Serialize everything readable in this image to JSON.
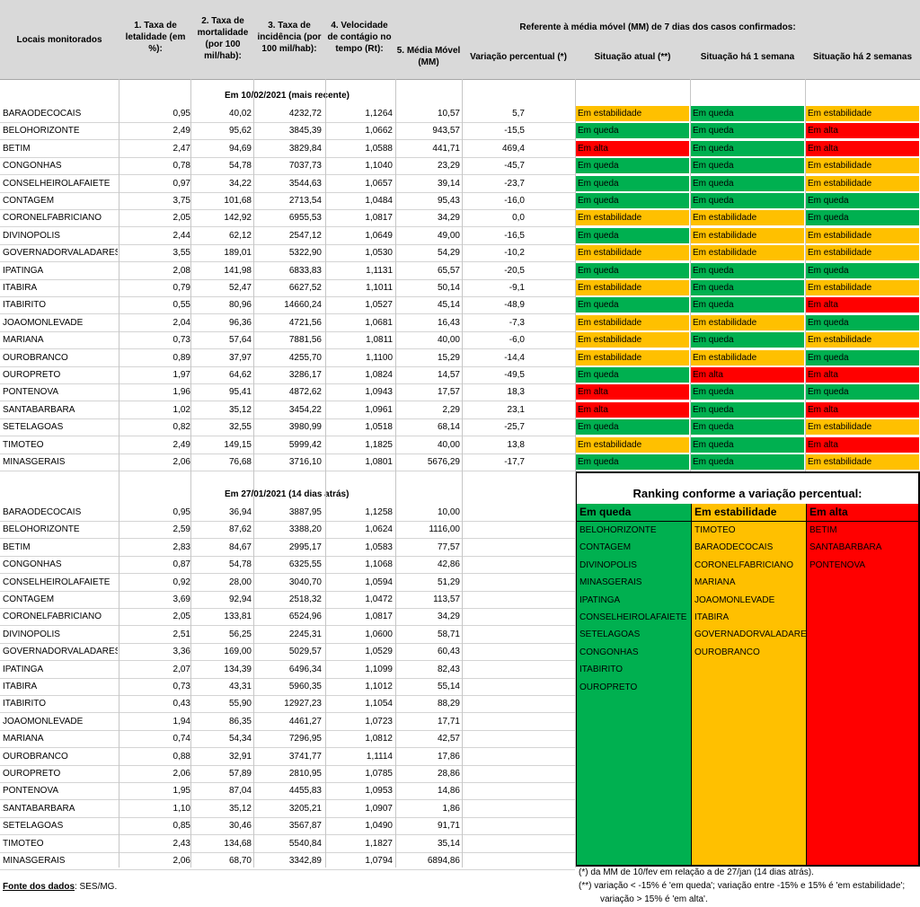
{
  "header": {
    "col_locais": "Locais monitorados",
    "col1": "1. Taxa de letalidade (em %):",
    "col2": "2. Taxa de mortalidade (por 100 mil/hab):",
    "col3": "3. Taxa de incidência (por 100 mil/hab):",
    "col4": "4. Velocidade de contágio no tempo (Rt):",
    "group": "Referente à média móvel (MM) de 7 dias  dos casos confirmados:",
    "col5": "5. Média Móvel (MM)",
    "col6": "Variação percentual (*)",
    "col7": "Situação atual (**)",
    "col8": "Situação há 1 semana",
    "col9": "Situação há 2 semanas"
  },
  "section1": {
    "title": "Em 10/02/2021 (mais recente)",
    "rows": [
      {
        "name": "BARAODECOCAIS",
        "c1": "0,95",
        "c2": "40,02",
        "c3": "4232,72",
        "c4": "1,1264",
        "c5": "10,57",
        "c6": "5,7",
        "s1": "Em estabilidade",
        "s2": "Em queda",
        "s3": "Em estabilidade"
      },
      {
        "name": "BELOHORIZONTE",
        "c1": "2,49",
        "c2": "95,62",
        "c3": "3845,39",
        "c4": "1,0662",
        "c5": "943,57",
        "c6": "-15,5",
        "s1": "Em queda",
        "s2": "Em queda",
        "s3": "Em alta"
      },
      {
        "name": "BETIM",
        "c1": "2,47",
        "c2": "94,69",
        "c3": "3829,84",
        "c4": "1,0588",
        "c5": "441,71",
        "c6": "469,4",
        "s1": "Em alta",
        "s2": "Em queda",
        "s3": "Em alta"
      },
      {
        "name": "CONGONHAS",
        "c1": "0,78",
        "c2": "54,78",
        "c3": "7037,73",
        "c4": "1,1040",
        "c5": "23,29",
        "c6": "-45,7",
        "s1": "Em queda",
        "s2": "Em queda",
        "s3": "Em estabilidade"
      },
      {
        "name": "CONSELHEIROLAFAIETE",
        "c1": "0,97",
        "c2": "34,22",
        "c3": "3544,63",
        "c4": "1,0657",
        "c5": "39,14",
        "c6": "-23,7",
        "s1": "Em queda",
        "s2": "Em queda",
        "s3": "Em estabilidade"
      },
      {
        "name": "CONTAGEM",
        "c1": "3,75",
        "c2": "101,68",
        "c3": "2713,54",
        "c4": "1,0484",
        "c5": "95,43",
        "c6": "-16,0",
        "s1": "Em queda",
        "s2": "Em queda",
        "s3": "Em queda"
      },
      {
        "name": "CORONELFABRICIANO",
        "c1": "2,05",
        "c2": "142,92",
        "c3": "6955,53",
        "c4": "1,0817",
        "c5": "34,29",
        "c6": "0,0",
        "s1": "Em estabilidade",
        "s2": "Em estabilidade",
        "s3": "Em queda"
      },
      {
        "name": "DIVINOPOLIS",
        "c1": "2,44",
        "c2": "62,12",
        "c3": "2547,12",
        "c4": "1,0649",
        "c5": "49,00",
        "c6": "-16,5",
        "s1": "Em queda",
        "s2": "Em estabilidade",
        "s3": "Em estabilidade"
      },
      {
        "name": "GOVERNADORVALADARES",
        "c1": "3,55",
        "c2": "189,01",
        "c3": "5322,90",
        "c4": "1,0530",
        "c5": "54,29",
        "c6": "-10,2",
        "s1": "Em estabilidade",
        "s2": "Em estabilidade",
        "s3": "Em estabilidade"
      },
      {
        "name": "IPATINGA",
        "c1": "2,08",
        "c2": "141,98",
        "c3": "6833,83",
        "c4": "1,1131",
        "c5": "65,57",
        "c6": "-20,5",
        "s1": "Em queda",
        "s2": "Em queda",
        "s3": "Em queda"
      },
      {
        "name": "ITABIRA",
        "c1": "0,79",
        "c2": "52,47",
        "c3": "6627,52",
        "c4": "1,1011",
        "c5": "50,14",
        "c6": "-9,1",
        "s1": "Em estabilidade",
        "s2": "Em queda",
        "s3": "Em estabilidade"
      },
      {
        "name": "ITABIRITO",
        "c1": "0,55",
        "c2": "80,96",
        "c3": "14660,24",
        "c4": "1,0527",
        "c5": "45,14",
        "c6": "-48,9",
        "s1": "Em queda",
        "s2": "Em queda",
        "s3": "Em alta"
      },
      {
        "name": "JOAOMONLEVADE",
        "c1": "2,04",
        "c2": "96,36",
        "c3": "4721,56",
        "c4": "1,0681",
        "c5": "16,43",
        "c6": "-7,3",
        "s1": "Em estabilidade",
        "s2": "Em estabilidade",
        "s3": "Em queda"
      },
      {
        "name": "MARIANA",
        "c1": "0,73",
        "c2": "57,64",
        "c3": "7881,56",
        "c4": "1,0811",
        "c5": "40,00",
        "c6": "-6,0",
        "s1": "Em estabilidade",
        "s2": "Em queda",
        "s3": "Em estabilidade"
      },
      {
        "name": "OUROBRANCO",
        "c1": "0,89",
        "c2": "37,97",
        "c3": "4255,70",
        "c4": "1,1100",
        "c5": "15,29",
        "c6": "-14,4",
        "s1": "Em estabilidade",
        "s2": "Em estabilidade",
        "s3": "Em queda"
      },
      {
        "name": "OUROPRETO",
        "c1": "1,97",
        "c2": "64,62",
        "c3": "3286,17",
        "c4": "1,0824",
        "c5": "14,57",
        "c6": "-49,5",
        "s1": "Em queda",
        "s2": "Em alta",
        "s3": "Em alta"
      },
      {
        "name": "PONTENOVA",
        "c1": "1,96",
        "c2": "95,41",
        "c3": "4872,62",
        "c4": "1,0943",
        "c5": "17,57",
        "c6": "18,3",
        "s1": "Em alta",
        "s2": "Em queda",
        "s3": "Em queda"
      },
      {
        "name": "SANTABARBARA",
        "c1": "1,02",
        "c2": "35,12",
        "c3": "3454,22",
        "c4": "1,0961",
        "c5": "2,29",
        "c6": "23,1",
        "s1": "Em alta",
        "s2": "Em queda",
        "s3": "Em alta"
      },
      {
        "name": "SETELAGOAS",
        "c1": "0,82",
        "c2": "32,55",
        "c3": "3980,99",
        "c4": "1,0518",
        "c5": "68,14",
        "c6": "-25,7",
        "s1": "Em queda",
        "s2": "Em queda",
        "s3": "Em estabilidade"
      },
      {
        "name": "TIMOTEO",
        "c1": "2,49",
        "c2": "149,15",
        "c3": "5999,42",
        "c4": "1,1825",
        "c5": "40,00",
        "c6": "13,8",
        "s1": "Em estabilidade",
        "s2": "Em queda",
        "s3": "Em alta"
      },
      {
        "name": "MINASGERAIS",
        "c1": "2,06",
        "c2": "76,68",
        "c3": "3716,10",
        "c4": "1,0801",
        "c5": "5676,29",
        "c6": "-17,7",
        "s1": "Em queda",
        "s2": "Em queda",
        "s3": "Em estabilidade"
      }
    ]
  },
  "section2": {
    "title": "Em 27/01/2021 (14 dias atrás)",
    "rows": [
      {
        "name": "BARAODECOCAIS",
        "c1": "0,95",
        "c2": "36,94",
        "c3": "3887,95",
        "c4": "1,1258",
        "c5": "10,00"
      },
      {
        "name": "BELOHORIZONTE",
        "c1": "2,59",
        "c2": "87,62",
        "c3": "3388,20",
        "c4": "1,0624",
        "c5": "1116,00"
      },
      {
        "name": "BETIM",
        "c1": "2,83",
        "c2": "84,67",
        "c3": "2995,17",
        "c4": "1,0583",
        "c5": "77,57"
      },
      {
        "name": "CONGONHAS",
        "c1": "0,87",
        "c2": "54,78",
        "c3": "6325,55",
        "c4": "1,1068",
        "c5": "42,86"
      },
      {
        "name": "CONSELHEIROLAFAIETE",
        "c1": "0,92",
        "c2": "28,00",
        "c3": "3040,70",
        "c4": "1,0594",
        "c5": "51,29"
      },
      {
        "name": "CONTAGEM",
        "c1": "3,69",
        "c2": "92,94",
        "c3": "2518,32",
        "c4": "1,0472",
        "c5": "113,57"
      },
      {
        "name": "CORONELFABRICIANO",
        "c1": "2,05",
        "c2": "133,81",
        "c3": "6524,96",
        "c4": "1,0817",
        "c5": "34,29"
      },
      {
        "name": "DIVINOPOLIS",
        "c1": "2,51",
        "c2": "56,25",
        "c3": "2245,31",
        "c4": "1,0600",
        "c5": "58,71"
      },
      {
        "name": "GOVERNADORVALADARES",
        "c1": "3,36",
        "c2": "169,00",
        "c3": "5029,57",
        "c4": "1,0529",
        "c5": "60,43"
      },
      {
        "name": "IPATINGA",
        "c1": "2,07",
        "c2": "134,39",
        "c3": "6496,34",
        "c4": "1,1099",
        "c5": "82,43"
      },
      {
        "name": "ITABIRA",
        "c1": "0,73",
        "c2": "43,31",
        "c3": "5960,35",
        "c4": "1,1012",
        "c5": "55,14"
      },
      {
        "name": "ITABIRITO",
        "c1": "0,43",
        "c2": "55,90",
        "c3": "12927,23",
        "c4": "1,1054",
        "c5": "88,29"
      },
      {
        "name": "JOAOMONLEVADE",
        "c1": "1,94",
        "c2": "86,35",
        "c3": "4461,27",
        "c4": "1,0723",
        "c5": "17,71"
      },
      {
        "name": "MARIANA",
        "c1": "0,74",
        "c2": "54,34",
        "c3": "7296,95",
        "c4": "1,0812",
        "c5": "42,57"
      },
      {
        "name": "OUROBRANCO",
        "c1": "0,88",
        "c2": "32,91",
        "c3": "3741,77",
        "c4": "1,1114",
        "c5": "17,86"
      },
      {
        "name": "OUROPRETO",
        "c1": "2,06",
        "c2": "57,89",
        "c3": "2810,95",
        "c4": "1,0785",
        "c5": "28,86"
      },
      {
        "name": "PONTENOVA",
        "c1": "1,95",
        "c2": "87,04",
        "c3": "4455,83",
        "c4": "1,0953",
        "c5": "14,86"
      },
      {
        "name": "SANTABARBARA",
        "c1": "1,10",
        "c2": "35,12",
        "c3": "3205,21",
        "c4": "1,0907",
        "c5": "1,86"
      },
      {
        "name": "SETELAGOAS",
        "c1": "0,85",
        "c2": "30,46",
        "c3": "3567,87",
        "c4": "1,0490",
        "c5": "91,71"
      },
      {
        "name": "TIMOTEO",
        "c1": "2,43",
        "c2": "134,68",
        "c3": "5540,84",
        "c4": "1,1827",
        "c5": "35,14"
      },
      {
        "name": "MINASGERAIS",
        "c1": "2,06",
        "c2": "68,70",
        "c3": "3342,89",
        "c4": "1,0794",
        "c5": "6894,86"
      }
    ]
  },
  "ranking": {
    "title": "Ranking conforme a variação percentual:",
    "queda_label": "Em queda",
    "estabilidade_label": "Em estabilidade",
    "alta_label": "Em alta",
    "queda": [
      "BELOHORIZONTE",
      "CONTAGEM",
      "DIVINOPOLIS",
      "MINASGERAIS",
      "IPATINGA",
      "CONSELHEIROLAFAIETE",
      "SETELAGOAS",
      "CONGONHAS",
      "ITABIRITO",
      "OUROPRETO"
    ],
    "estabilidade": [
      "TIMOTEO",
      "BARAODECOCAIS",
      "CORONELFABRICIANO",
      "MARIANA",
      "JOAOMONLEVADE",
      "ITABIRA",
      "GOVERNADORVALADARES",
      "OUROBRANCO"
    ],
    "alta": [
      "BETIM",
      "SANTABARBARA",
      "PONTENOVA"
    ]
  },
  "footer": {
    "fonte_label": "Fonte dos dados",
    "fonte_value": ": SES/MG.",
    "note1": "(*) da MM de 10/fev em relação a de 27/jan (14 dias atrás).",
    "note2": "(**) variação <   -15% é 'em queda'; variação entre -15% e 15% é 'em estabilidade';",
    "note3": "variação > 15% é 'em alta'."
  },
  "colors": {
    "queda": "#00b050",
    "estabilidade": "#ffc000",
    "alta": "#ff0000",
    "header_bg": "#d9d9d9"
  }
}
